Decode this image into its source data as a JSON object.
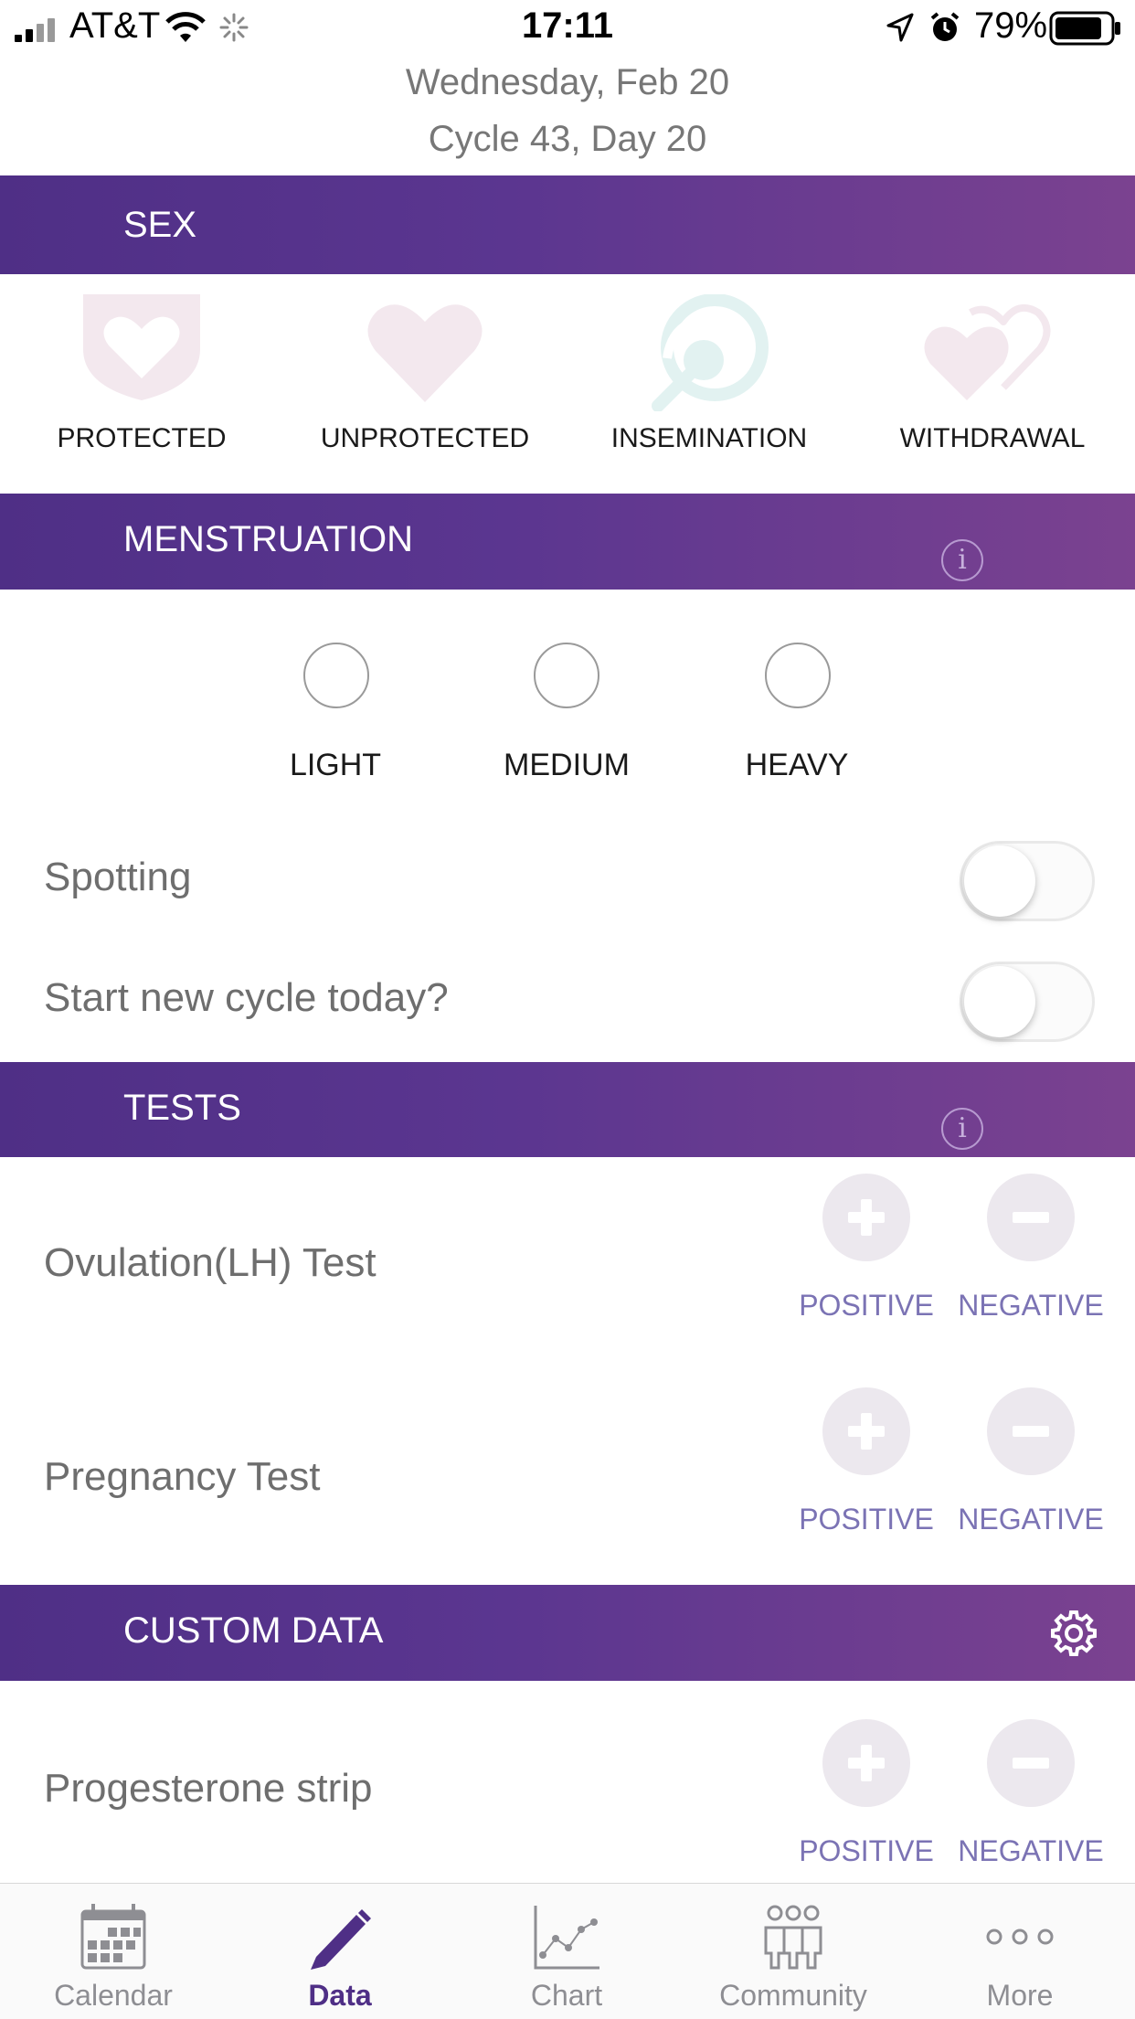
{
  "status_bar": {
    "carrier": "AT&T",
    "time": "17:11",
    "battery": "79%"
  },
  "header": {
    "date": "Wednesday, Feb 20",
    "cycle": "Cycle 43, Day 20"
  },
  "sections": {
    "sex": {
      "title": "SEX",
      "options": [
        "PROTECTED",
        "UNPROTECTED",
        "INSEMINATION",
        "WITHDRAWAL"
      ]
    },
    "menstruation": {
      "title": "MENSTRUATION",
      "flow": [
        "LIGHT",
        "MEDIUM",
        "HEAVY"
      ],
      "spotting_label": "Spotting",
      "spotting_on": false,
      "new_cycle_label": "Start new cycle today?",
      "new_cycle_on": false
    },
    "tests": {
      "title": "TESTS",
      "items": [
        {
          "label": "Ovulation(LH) Test",
          "positive": "POSITIVE",
          "negative": "NEGATIVE"
        },
        {
          "label": "Pregnancy Test",
          "positive": "POSITIVE",
          "negative": "NEGATIVE"
        }
      ]
    },
    "custom": {
      "title": "CUSTOM DATA",
      "items": [
        {
          "label": "Progesterone strip",
          "positive": "POSITIVE",
          "negative": "NEGATIVE"
        }
      ]
    }
  },
  "tabs": [
    {
      "label": "Calendar",
      "icon": "calendar-icon",
      "active": false
    },
    {
      "label": "Data",
      "icon": "pencil-icon",
      "active": true
    },
    {
      "label": "Chart",
      "icon": "chart-icon",
      "active": false
    },
    {
      "label": "Community",
      "icon": "community-icon",
      "active": false
    },
    {
      "label": "More",
      "icon": "more-icon",
      "active": false
    }
  ],
  "colors": {
    "bar_start": "#4f2f86",
    "bar_end": "#7b4290",
    "sex_icon_pink": "#f3e8ee",
    "insemination_icon": "#e2f2f1",
    "test_label": "#7b73b4",
    "active_tab": "#4f2f86"
  }
}
